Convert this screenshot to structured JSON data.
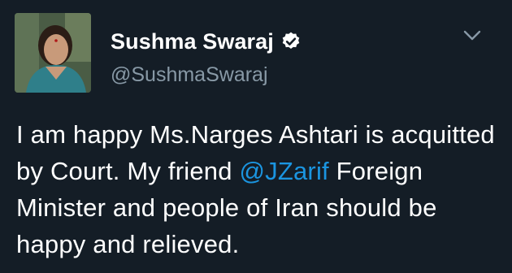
{
  "tweet": {
    "author": {
      "display_name": "Sushma Swaraj",
      "handle": "@SushmaSwaraj",
      "verified": true,
      "avatar_icon": "profile-photo"
    },
    "menu_icon": "chevron-down-icon",
    "text_part1": "I am happy Ms.Narges Ashtari is acquitted by Court. My friend ",
    "mention": "@JZarif",
    "text_part2": " Foreign Minister and people of Iran should be happy and relieved."
  },
  "colors": {
    "background": "#141d26",
    "text": "#ffffff",
    "secondary_text": "#8899a6",
    "link": "#1b95e0"
  }
}
